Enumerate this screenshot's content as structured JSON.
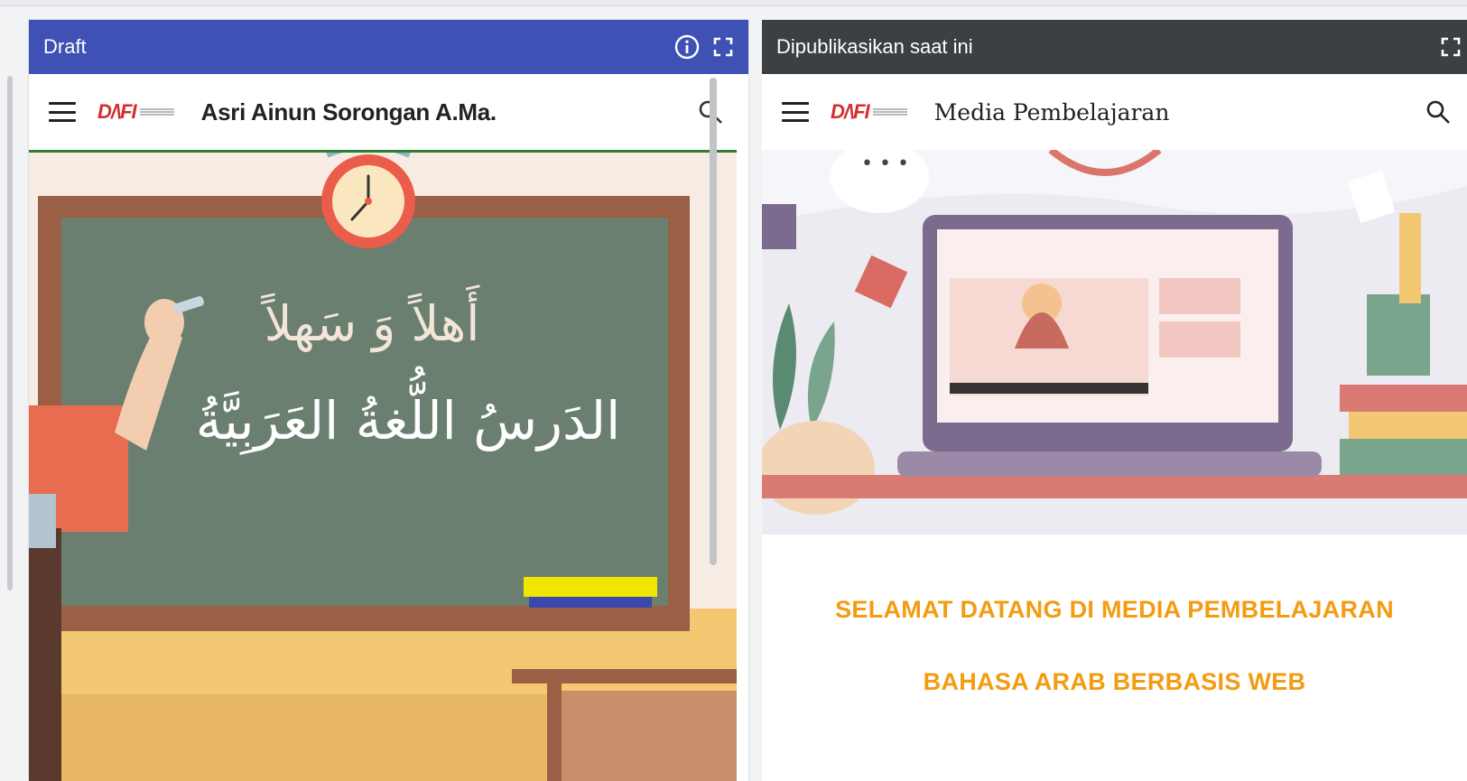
{
  "draft_panel": {
    "title": "Draft",
    "icons": [
      "info-icon",
      "fullscreen-icon"
    ],
    "site": {
      "logo_text": "D/\\FI",
      "title": "Asri Ainun Sorongan A.Ma.",
      "icons": [
        "menu-icon",
        "search-icon"
      ]
    },
    "hero": {
      "arabic_line1": "أَهلاً وَ سَهلاً",
      "arabic_line2": "الدَرسُ اللُّغةُ العَرَبِيَّةُ"
    }
  },
  "published_panel": {
    "title": "Dipublikasikan saat ini",
    "icons": [
      "fullscreen-icon"
    ],
    "site": {
      "logo_text": "D/\\FI",
      "title": "Media Pembelajaran",
      "icons": [
        "menu-icon",
        "search-icon"
      ]
    },
    "welcome_line1": "SELAMAT DATANG DI MEDIA PEMBELAJARAN",
    "welcome_line2": "BAHASA ARAB BERBASIS WEB"
  },
  "colors": {
    "draft_bar": "#3f51b5",
    "published_bar": "#3c4043",
    "chalkboard": "#6a7f6f",
    "board_frame": "#9a5f45",
    "welcome_text": "#f39c12",
    "logo_red": "#d62d2d"
  }
}
